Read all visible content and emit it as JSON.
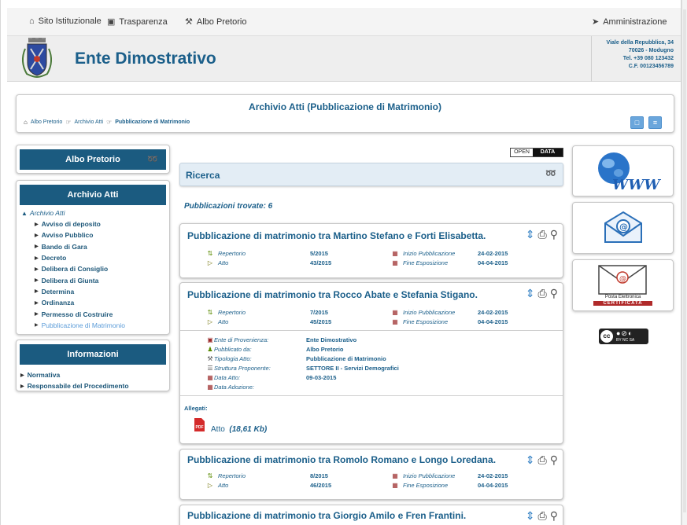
{
  "topbar": {
    "links": [
      {
        "label": "Sito Istituzionale",
        "icon": "home-icon"
      },
      {
        "label": "Trasparenza",
        "icon": "bank-icon"
      },
      {
        "label": "Albo Pretorio",
        "icon": "gavel-icon"
      }
    ],
    "admin_label": "Amministrazione"
  },
  "header": {
    "site_title": "Ente Dimostrativo",
    "address_lines": [
      "Viale della Repubblica, 34",
      "70026 - Modugno",
      "Tel. +39 080 123432",
      "C.F. 00123456789"
    ]
  },
  "title_box": {
    "title": "Archivio Atti (Pubblicazione di Matrimonio)",
    "breadcrumb": [
      "Albo Pretorio",
      "Archivio Atti",
      "Pubblicazione di Matrimonio"
    ]
  },
  "sidebar": {
    "albo_label": "Albo Pretorio",
    "archivio_label": "Archivio Atti",
    "archivio_root": "Archivio Atti",
    "archivio_items": [
      "Avviso di deposito",
      "Avviso Pubblico",
      "Bando di Gara",
      "Decreto",
      "Delibera di Consiglio",
      "Delibera di Giunta",
      "Determina",
      "Ordinanza",
      "Permesso di Costruire",
      "Pubblicazione di Matrimonio"
    ],
    "info_label": "Informazioni",
    "info_items": [
      "Normativa",
      "Responsabile del Procedimento"
    ]
  },
  "main": {
    "opendata": {
      "open": "OPEN",
      "data": "DATA"
    },
    "ricerca_label": "Ricerca",
    "found_text": "Pubblicazioni trovate: 6",
    "labels": {
      "repertorio": "Repertorio",
      "atto": "Atto",
      "inizio": "Inizio Pubblicazione",
      "fine": "Fine Esposizione"
    },
    "cards": [
      {
        "title": "Pubblicazione di matrimonio tra Martino Stefano e Forti Elisabetta.",
        "repertorio": "5/2015",
        "atto": "43/2015",
        "inizio": "24-02-2015",
        "fine": "04-04-2015"
      },
      {
        "title": "Pubblicazione di matrimonio tra Rocco Abate e Stefania Stigano.",
        "repertorio": "7/2015",
        "atto": "45/2015",
        "inizio": "24-02-2015",
        "fine": "04-04-2015"
      },
      {
        "title": "Pubblicazione di matrimonio tra Romolo Romano e Longo Loredana.",
        "repertorio": "8/2015",
        "atto": "46/2015",
        "inizio": "24-02-2015",
        "fine": "04-04-2015"
      },
      {
        "title": "Pubblicazione di matrimonio tra Giorgio Amilo e Fren Frantini."
      }
    ],
    "details": [
      {
        "label": "Ente di Provenienza:",
        "value": "Ente Dimostrativo",
        "icon": "bank-icon"
      },
      {
        "label": "Pubblicato da:",
        "value": "Albo Pretorio",
        "icon": "user-icon"
      },
      {
        "label": "Tipologia Atto:",
        "value": "Pubblicazione di Matrimonio",
        "icon": "gavel-icon"
      },
      {
        "label": "Struttura Proponente:",
        "value": "SETTORE II - Servizi Demografici",
        "icon": "list-icon"
      },
      {
        "label": "Data Atto:",
        "value": "09-03-2015",
        "icon": "calendar-icon"
      },
      {
        "label": "Data Adozione:",
        "value": "",
        "icon": "calendar-icon"
      }
    ],
    "allegati_label": "Allegati:",
    "attachment": {
      "name": "Atto",
      "size": "(18,61 Kb)",
      "pdf_text": "PDF"
    }
  },
  "right": {
    "pec_line1": "Posta Elettronica",
    "pec_line2": "CERTIFICATA",
    "cc_text": "BY NC SA"
  }
}
